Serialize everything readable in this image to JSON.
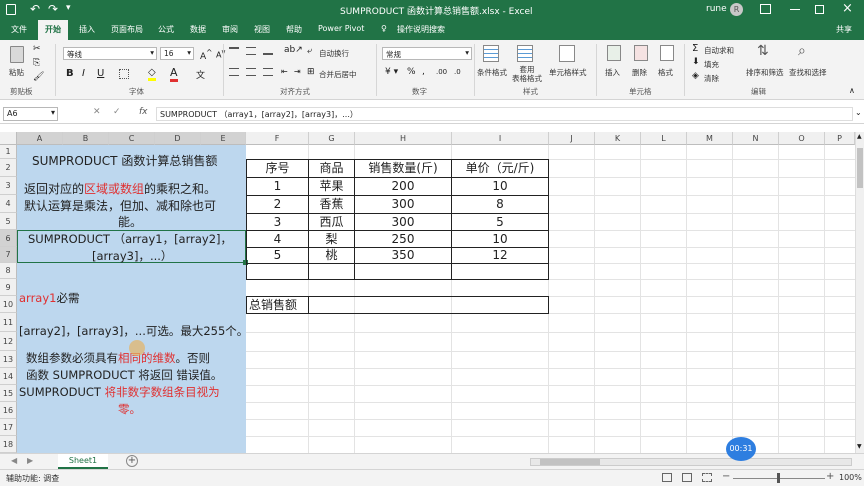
{
  "window": {
    "title": "SUMPRODUCT 函数计算总销售额.xlsx - Excel",
    "user": "rune",
    "user_initial": "R"
  },
  "quick_access": {
    "autosave_label": "↶"
  },
  "menu": {
    "tabs": [
      "文件",
      "开始",
      "插入",
      "页面布局",
      "公式",
      "数据",
      "审阅",
      "视图",
      "帮助",
      "Power Pivot"
    ],
    "active": "开始",
    "search_label": "操作说明搜索",
    "share_label": "共享"
  },
  "ribbon": {
    "clipboard": {
      "paste": "粘贴",
      "group": "剪贴板"
    },
    "font": {
      "name": "等线",
      "size": "16",
      "group": "字体",
      "bold": "B",
      "italic": "I",
      "underline": "U"
    },
    "alignment": {
      "wrap": "自动换行",
      "merge": "合并后居中",
      "group": "对齐方式"
    },
    "number": {
      "format": "常规",
      "group": "数字"
    },
    "styles": {
      "conditional": "条件格式",
      "table": "套用\n表格格式",
      "cell_styles": "单元格样式",
      "group": "样式"
    },
    "cells": {
      "insert": "插入",
      "delete": "删除",
      "format": "格式",
      "group": "单元格"
    },
    "editing": {
      "autosum": "自动求和",
      "fill": "填充",
      "clear": "清除",
      "sort": "排序和筛选",
      "find": "查找和选择",
      "group": "编辑"
    }
  },
  "formula_bar": {
    "name_box": "A6",
    "fx": "fx",
    "formula": "SUMPRODUCT （array1，[array2]，[array3]，...）"
  },
  "columns": [
    "A",
    "B",
    "C",
    "D",
    "E",
    "F",
    "G",
    "H",
    "I",
    "J",
    "K",
    "L",
    "M",
    "N",
    "O",
    "P"
  ],
  "rows": [
    "1",
    "2",
    "3",
    "4",
    "5",
    "6",
    "7",
    "8",
    "9",
    "10",
    "11",
    "12",
    "13",
    "14",
    "15",
    "16",
    "17",
    "18"
  ],
  "notes": {
    "title": "SUMPRODUCT 函数计算总销售额",
    "desc1a": "返回对应的",
    "desc1b": "区域或数组",
    "desc1c": "的乘积之和。",
    "desc2": "默认运算是乘法，但加、减和除也可",
    "desc3": "能。",
    "syntax1": "SUMPRODUCT （array1，[array2]，",
    "syntax2": "[array3]，...）",
    "req_a": "array1",
    "req_b": "必需",
    "optional": "[array2]，[array3]，...可选。最大255个。",
    "dims_a": "数组参数必须具有",
    "dims_b": "相同的维数",
    "dims_c": "。否则",
    "err": "函数 SUMPRODUCT 将返回 错误值。",
    "nonnum_a": "SUMPRODUCT ",
    "nonnum_b": "将非数字数组条目视为",
    "nonnum_c": "零。"
  },
  "table": {
    "headers": [
      "序号",
      "商品",
      "销售数量(斤)",
      "单价（元/斤)"
    ],
    "rows": [
      [
        "1",
        "苹果",
        "200",
        "10"
      ],
      [
        "2",
        "香蕉",
        "300",
        "8"
      ],
      [
        "3",
        "西瓜",
        "300",
        "5"
      ],
      [
        "4",
        "梨",
        "250",
        "10"
      ],
      [
        "5",
        "桃",
        "350",
        "12"
      ]
    ],
    "total_label": "总销售额"
  },
  "sheet_tabs": {
    "active": "Sheet1",
    "add": "+"
  },
  "status": {
    "left": "辅助功能: 调查",
    "zoom": "100%",
    "timer": "00:31"
  },
  "colors": {
    "excel_green": "#217346",
    "note_fill": "#bdd7ee",
    "red": "#e03030"
  }
}
